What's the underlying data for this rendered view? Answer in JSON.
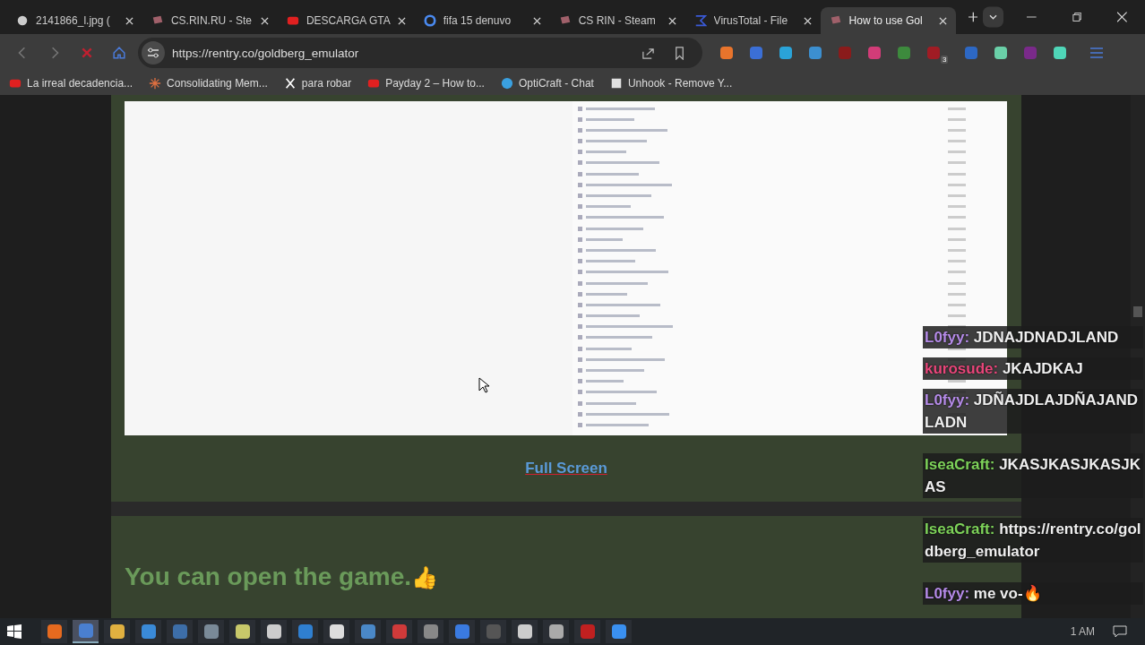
{
  "tabs": [
    {
      "title": "2141866_l.jpg (",
      "selected": false
    },
    {
      "title": "CS.RIN.RU - Ste",
      "selected": false
    },
    {
      "title": "DESCARGA GTA",
      "selected": false
    },
    {
      "title": "fifa 15 denuvo",
      "selected": false
    },
    {
      "title": "CS RIN - Steam",
      "selected": false
    },
    {
      "title": "VirusTotal - File",
      "selected": false
    },
    {
      "title": "How to use Gol",
      "selected": true
    }
  ],
  "address_bar": {
    "url": "https://rentry.co/goldberg_emulator"
  },
  "extensions": [
    {
      "color": "#e8742c"
    },
    {
      "color": "#3b6fd6"
    },
    {
      "color": "#2aa3d8"
    },
    {
      "color": "#3c8fd0"
    },
    {
      "color": "#8a1b1b"
    },
    {
      "color": "#d23c78"
    },
    {
      "color": "#3d8a3d"
    },
    {
      "color": "#a01c24",
      "badge": "3"
    },
    {
      "color": "#2d68c4"
    },
    {
      "color": "#6ad0a8"
    },
    {
      "color": "#7a2a8a"
    },
    {
      "color": "#4fd6b8"
    }
  ],
  "bookmarks": [
    {
      "label": "La irreal decadencia..."
    },
    {
      "label": "Consolidating Mem..."
    },
    {
      "label": "para robar"
    },
    {
      "label": "Payday 2 – How to..."
    },
    {
      "label": "OptiCraft - Chat"
    },
    {
      "label": "Unhook - Remove Y..."
    }
  ],
  "page": {
    "link": "Full Screen",
    "heading": "You can open the game.",
    "heading_emoji": "👍"
  },
  "chat": [
    {
      "user": "L0fyy:",
      "color": "#b58be8",
      "text": "JDNAJDNADJLAND"
    },
    {
      "user": "kurosude:",
      "color": "#e8467a",
      "text": "JKAJDKAJ"
    },
    {
      "user": "L0fyy:",
      "color": "#b58be8",
      "text": "JDÑAJDLAJDÑAJANDLADN"
    },
    {
      "user": "IseaCraft:",
      "color": "#7ed35a",
      "text": "JKASJKASJKASJKAS"
    },
    {
      "user": "IseaCraft:",
      "color": "#7ed35a",
      "text": "https://rentry.co/goldberg_emulator"
    },
    {
      "user": "L0fyy:",
      "color": "#b58be8",
      "text": "me vo-🔥"
    }
  ],
  "taskbar": {
    "apps": [
      {
        "color": "#e66a1f",
        "selected": false
      },
      {
        "color": "#4a7fd0",
        "selected": true
      },
      {
        "color": "#e0b040",
        "selected": false
      },
      {
        "color": "#3a8ad8",
        "selected": false
      },
      {
        "color": "#3d6ea8",
        "selected": false
      },
      {
        "color": "#7a8a98",
        "selected": false
      },
      {
        "color": "#c8c86a",
        "selected": false
      },
      {
        "color": "#cccccc",
        "selected": false
      },
      {
        "color": "#2f7fd0",
        "selected": false
      },
      {
        "color": "#dddddd",
        "selected": false
      },
      {
        "color": "#4a88c8",
        "selected": false
      },
      {
        "color": "#d03a3a",
        "selected": false
      },
      {
        "color": "#888888",
        "selected": false
      },
      {
        "color": "#3a7ae0",
        "selected": false
      },
      {
        "color": "#555555",
        "selected": false
      },
      {
        "color": "#cccccc",
        "selected": false
      },
      {
        "color": "#aaaaaa",
        "selected": false
      },
      {
        "color": "#c02020",
        "selected": false
      },
      {
        "color": "#3a90f0",
        "selected": false
      }
    ],
    "clock": "1 AM"
  }
}
